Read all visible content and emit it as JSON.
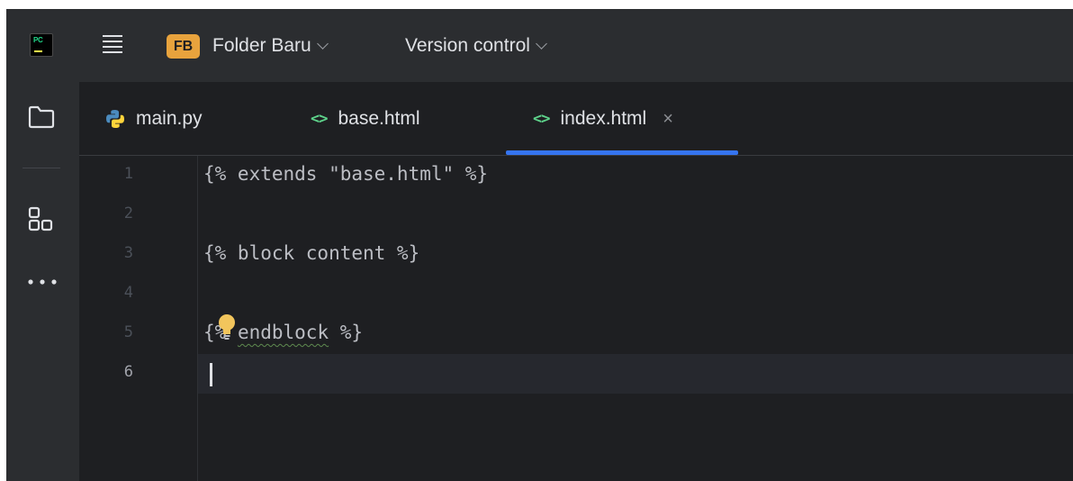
{
  "titlebar": {
    "app_icon": "pycharm-logo",
    "app_icon_text": "PC",
    "menu_icon": "hamburger-menu-icon",
    "project_badge": "FB",
    "project_name": "Folder Baru",
    "vcs_label": "Version control"
  },
  "toolstrip": {
    "items": [
      {
        "icon": "folder-icon",
        "label": "Project"
      },
      {
        "icon": "structure-icon",
        "label": "Structure"
      },
      {
        "icon": "more-icon",
        "label": "More"
      }
    ]
  },
  "tabs": [
    {
      "label": "main.py",
      "icon": "python-icon",
      "active": false
    },
    {
      "label": "base.html",
      "icon": "html-icon",
      "icon_text": "<>",
      "active": false
    },
    {
      "label": "index.html",
      "icon": "html-icon",
      "icon_text": "<>",
      "active": true,
      "close": "×"
    }
  ],
  "editor": {
    "lines": [
      {
        "num": "1",
        "text": "{% extends \"base.html\" %}"
      },
      {
        "num": "2",
        "text": ""
      },
      {
        "num": "3",
        "text": "{% block content %}"
      },
      {
        "num": "4",
        "text": ""
      },
      {
        "num": "5",
        "text_prefix": "{% ",
        "text_squiggle": "endblock",
        "text_suffix": " %}"
      },
      {
        "num": "6",
        "text": ""
      }
    ],
    "current_line": "6",
    "intention_icon": "lightbulb-icon"
  },
  "colors": {
    "accent": "#3574f0",
    "project_badge": "#e8a33d",
    "html_icon": "#5ed38b",
    "bulb": "#f2c55c"
  }
}
